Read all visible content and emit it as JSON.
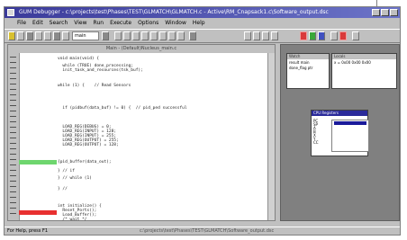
{
  "window": {
    "title": "GUM Debugger - c:\\projects\\test\\Phases\\TEST\\GLMATCH\\GLMATCH.c - Active\\RM_Cnapsack1.c\\Software_output.dsc",
    "menu": [
      "File",
      "Edit",
      "Search",
      "View",
      "Run",
      "Execute",
      "Options",
      "Window",
      "Help"
    ]
  },
  "toolbar": {
    "combo_value": "main"
  },
  "editor": {
    "title": "Main - (Default)Nucleus_main.c",
    "code_lines": [
      "void main(void) {",
      "  while (TRUE) done_processing;",
      "  init_task_and_resources(tsk_buf);",
      "",
      "while (1) {    // Read Sensors",
      "",
      "  if (pidbuf(data_buf) != 0) {  // pid_ped successful",
      "",
      "",
      "  LOAD_REG(DEBUG) = 0;",
      "  LOAD_REG(INPUT) = 128;",
      "  LOAD_REG(INPUT) = 255;",
      "  LOAD_REG(OUTPUT) = 255;",
      "  LOAD_REG(OUTPUT) = 128;",
      "",
      "{pid_buffer(data_out);",
      "",
      "} // if",
      "} // while (1)",
      "",
      "} //",
      "",
      "",
      "int initialize() {",
      "  Reset_Ports();",
      "  Load_Buffer();",
      "  /* wait */"
    ]
  },
  "watch_window": {
    "title": "Watch",
    "lines": [
      "result main",
      "done_flag ptr"
    ]
  },
  "locals_window": {
    "title": "Locals",
    "lines": [
      "x = 0x00 0x00 0x00"
    ]
  },
  "registers_window": {
    "title": "CPU Registers",
    "rows": [
      "PC",
      "SP",
      "A",
      "B",
      "X",
      "Y",
      "CC"
    ]
  },
  "statusbar": {
    "left": "For Help, press F1",
    "middle": "c:\\projects\\test\\Phases\\TEST\\GLMATCH\\Software_output.dsc"
  },
  "colors": {
    "titlebar": "#3a3a9a",
    "breakpoint_green": "#6ed66e",
    "breakpoint_red": "#e83030",
    "register_selection": "#1a1a9a"
  }
}
